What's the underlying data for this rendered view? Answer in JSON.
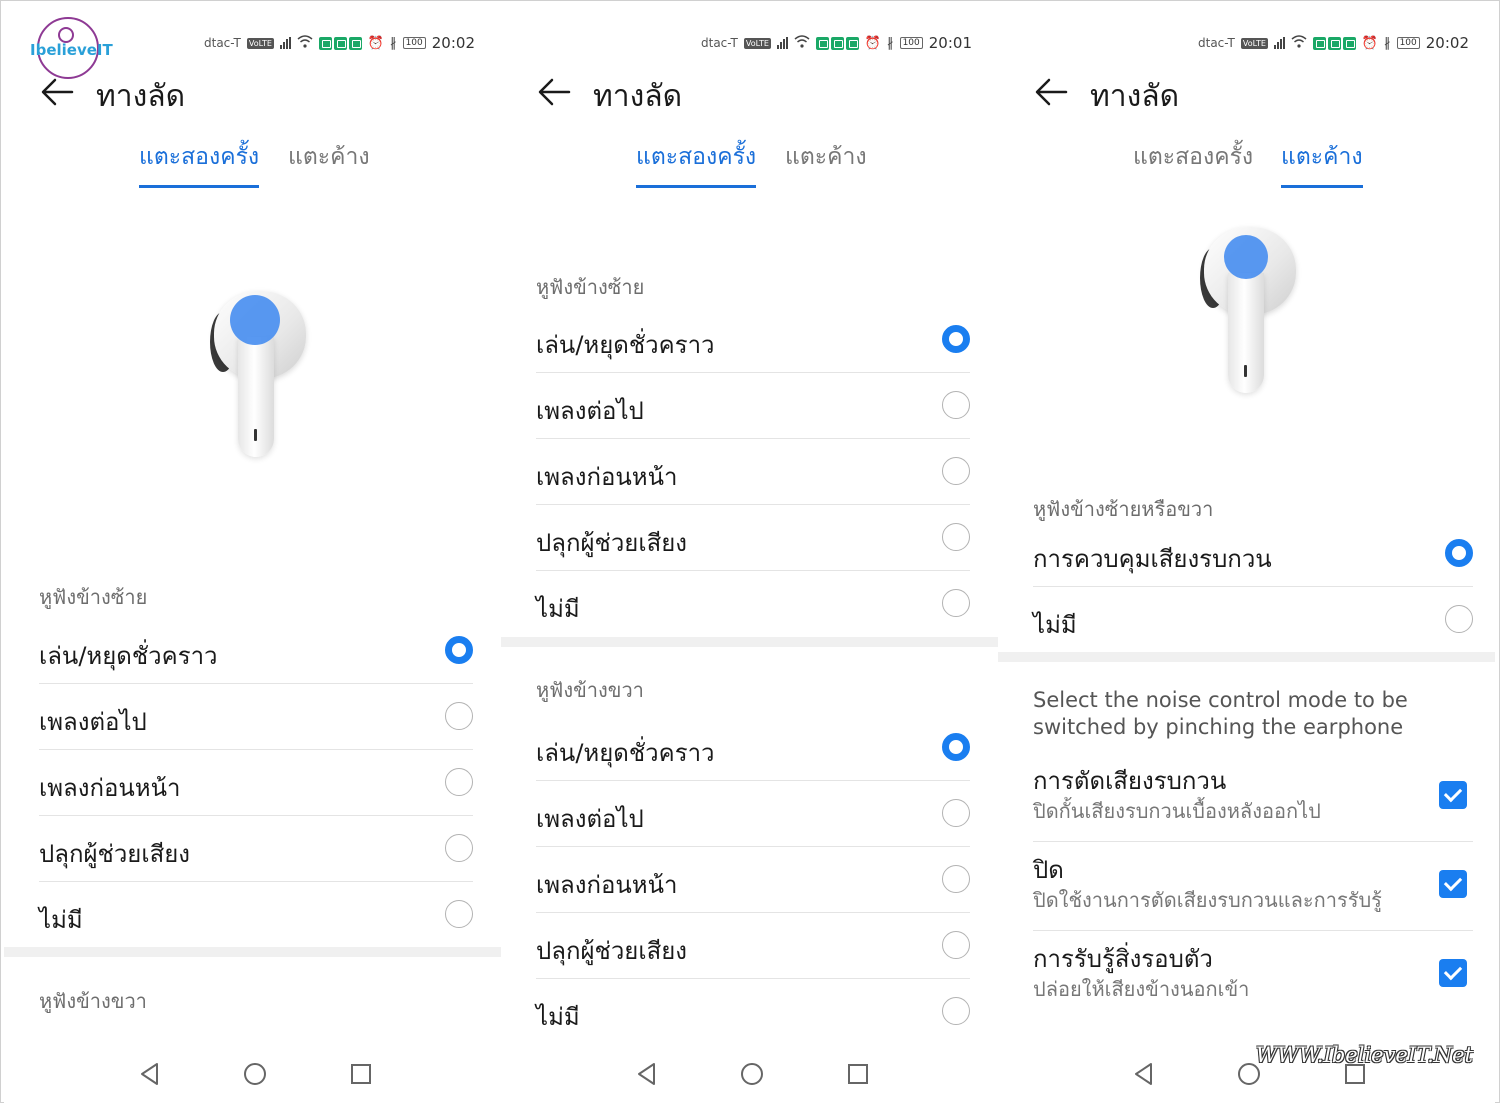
{
  "brand": {
    "logo_text": "IbelieveIT",
    "watermark": "WWW.IbelieveIT.Net",
    "accent": "#1a7ef0"
  },
  "screens": [
    {
      "status": {
        "carrier": "dtac-T",
        "time": "20:02",
        "battery": "100"
      },
      "title": "ทางลัด",
      "tabs": [
        {
          "label": "แตะสองครั้ง",
          "active": true
        },
        {
          "label": "แตะค้าง",
          "active": false
        }
      ],
      "sections": [
        {
          "label": "หูฟังข้างซ้าย",
          "options": [
            {
              "label": "เล่น/หยุดชั่วคราว",
              "selected": true
            },
            {
              "label": "เพลงต่อไป",
              "selected": false
            },
            {
              "label": "เพลงก่อนหน้า",
              "selected": false
            },
            {
              "label": "ปลุกผู้ช่วยเสียง",
              "selected": false
            },
            {
              "label": "ไม่มี",
              "selected": false
            }
          ]
        },
        {
          "label": "หูฟังข้างขวา",
          "options": []
        }
      ]
    },
    {
      "status": {
        "carrier": "dtac-T",
        "time": "20:01",
        "battery": "100"
      },
      "title": "ทางลัด",
      "tabs": [
        {
          "label": "แตะสองครั้ง",
          "active": true
        },
        {
          "label": "แตะค้าง",
          "active": false
        }
      ],
      "sections": [
        {
          "label": "หูฟังข้างซ้าย",
          "options": [
            {
              "label": "เล่น/หยุดชั่วคราว",
              "selected": true
            },
            {
              "label": "เพลงต่อไป",
              "selected": false
            },
            {
              "label": "เพลงก่อนหน้า",
              "selected": false
            },
            {
              "label": "ปลุกผู้ช่วยเสียง",
              "selected": false
            },
            {
              "label": "ไม่มี",
              "selected": false
            }
          ]
        },
        {
          "label": "หูฟังข้างขวา",
          "options": [
            {
              "label": "เล่น/หยุดชั่วคราว",
              "selected": true
            },
            {
              "label": "เพลงต่อไป",
              "selected": false
            },
            {
              "label": "เพลงก่อนหน้า",
              "selected": false
            },
            {
              "label": "ปลุกผู้ช่วยเสียง",
              "selected": false
            },
            {
              "label": "ไม่มี",
              "selected": false
            }
          ]
        }
      ]
    },
    {
      "status": {
        "carrier": "dtac-T",
        "time": "20:02",
        "battery": "100"
      },
      "title": "ทางลัด",
      "tabs": [
        {
          "label": "แตะสองครั้ง",
          "active": false
        },
        {
          "label": "แตะค้าง",
          "active": true
        }
      ],
      "sections": [
        {
          "label": "หูฟังข้างซ้ายหรือขวา",
          "options": [
            {
              "label": "การควบคุมเสียงรบกวน",
              "selected": true
            },
            {
              "label": "ไม่มี",
              "selected": false
            }
          ]
        }
      ],
      "note": "Select the noise control mode to be switched by pinching the earphone",
      "modes": [
        {
          "title": "การตัดเสียงรบกวน",
          "subtitle": "ปิดกั้นเสียงรบกวนเบื้องหลังออกไป",
          "checked": true
        },
        {
          "title": "ปิด",
          "subtitle": "ปิดใช้งานการตัดเสียงรบกวนและการรับรู้",
          "checked": true
        },
        {
          "title": "การรับรู้สิ่งรอบตัว",
          "subtitle": "ปล่อยให้เสียงข้างนอกเข้า",
          "checked": true
        }
      ]
    }
  ]
}
